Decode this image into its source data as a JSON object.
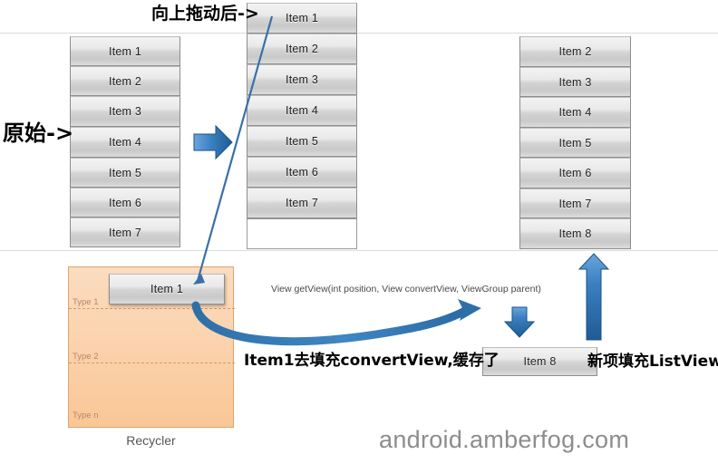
{
  "labels": {
    "original": "原始->",
    "after_drag_up": "向上拖动后->",
    "item1_fills_convertview": "Item1去填充convertView,缓存了",
    "new_item_fills_listview": "新项填充ListView底",
    "getview_signature": "View getView(int position, View convertView, ViewGroup parent)",
    "recycler_caption": "Recycler",
    "signature": "android.amberfog.com"
  },
  "lists": {
    "original": {
      "title": "original-list",
      "items": [
        "Item 1",
        "Item 2",
        "Item 3",
        "Item 4",
        "Item 5",
        "Item 6",
        "Item 7"
      ]
    },
    "scrolled": {
      "title": "scrolled-list",
      "items": [
        "Item 1",
        "Item 2",
        "Item 3",
        "Item 4",
        "Item 5",
        "Item 6",
        "Item 7"
      ],
      "empty_slot": ""
    },
    "final": {
      "title": "final-list",
      "items": [
        "Item 2",
        "Item 3",
        "Item 4",
        "Item 5",
        "Item 6",
        "Item 7",
        "Item 8"
      ]
    }
  },
  "recycler": {
    "cached_item": "Item 1",
    "types": [
      "Type 1",
      "Type 2",
      "Type n"
    ]
  },
  "new_item": {
    "label": "Item 8"
  },
  "colors": {
    "arrow_blue": "#2e74b5",
    "arrow_blue_dark": "#1f5b94",
    "recycler_orange": "#f9c796",
    "recycler_border": "#e0a36a",
    "rule_gray": "#d5dde5",
    "signature_gray": "#8d8d8d"
  }
}
